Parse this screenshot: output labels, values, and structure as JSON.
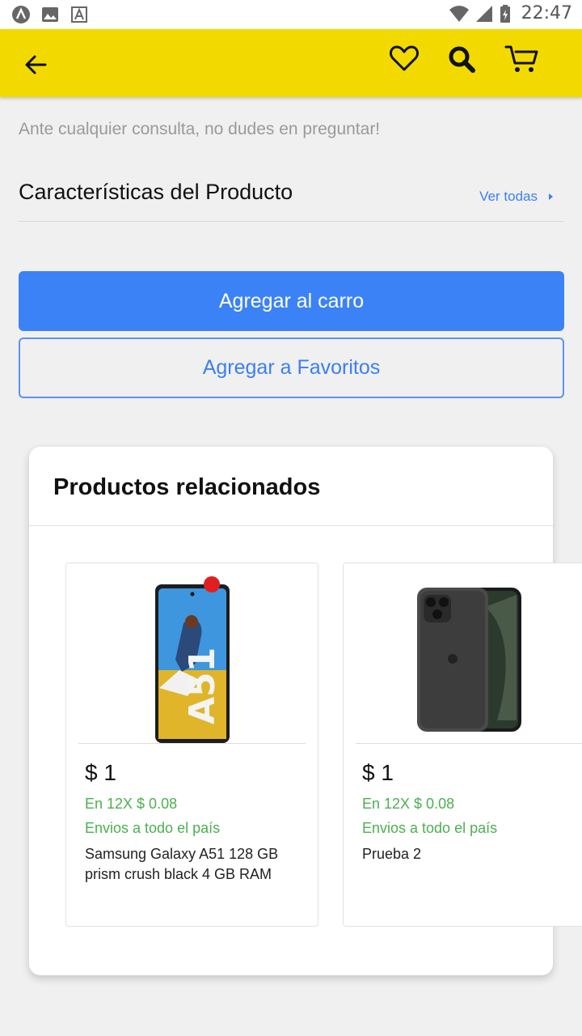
{
  "status_bar": {
    "time": "22:47",
    "icons": [
      "app-icon",
      "image-icon",
      "font-icon",
      "wifi-icon",
      "signal-icon",
      "battery-icon"
    ]
  },
  "app_bar": {
    "background": "#f2da00",
    "icons": [
      "back-arrow-icon",
      "heart-icon",
      "search-icon",
      "cart-icon"
    ]
  },
  "hint_text": "Ante cualquier consulta, no dudes en preguntar!",
  "features": {
    "title": "Características del Producto",
    "see_all": "Ver todas"
  },
  "actions": {
    "add_to_cart": "Agregar al carro",
    "add_to_favorites": "Agregar a Favoritos"
  },
  "related": {
    "title": "Productos relacionados",
    "products": [
      {
        "price": "$ 1",
        "installments": "En 12X $ 0.08",
        "shipping": "Envios a todo el país",
        "name": "Samsung Galaxy A51 128 GB prism crush black 4 GB RAM",
        "image": "samsung-galaxy-a51-phone-image"
      },
      {
        "price": "$ 1",
        "installments": "En 12X $ 0.08",
        "shipping": "Envios a todo el país",
        "name": "Prueba 2",
        "image": "iphone-11-pro-phone-image"
      }
    ]
  },
  "colors": {
    "primary": "#3b82f6",
    "accent_green": "#4caf50",
    "brand_yellow": "#f2da00"
  }
}
